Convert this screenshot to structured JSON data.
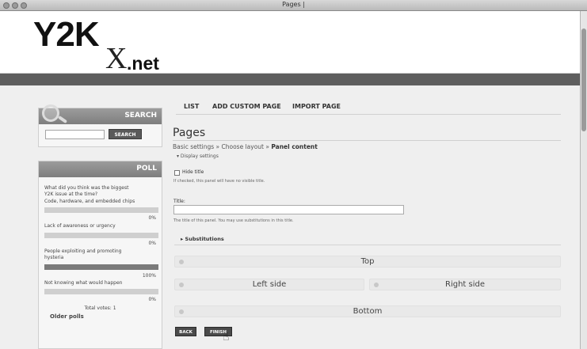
{
  "window": {
    "title": "Pages |"
  },
  "logo": {
    "main": "Y2K",
    "x": "X",
    "net": ".net"
  },
  "search": {
    "title": "SEARCH",
    "button_label": "SEARCH"
  },
  "poll": {
    "title": "POLL",
    "question": [
      "What did you think was the biggest",
      "Y2K issue at the time?"
    ],
    "options": [
      {
        "label": [
          "Code, hardware, and embedded chips"
        ],
        "percent_text": "0%",
        "fraction": 0
      },
      {
        "label": [
          "Lack of awareness or urgency"
        ],
        "percent_text": "0%",
        "fraction": 0
      },
      {
        "label": [
          "People exploiting and promoting",
          "hysteria"
        ],
        "percent_text": "100%",
        "fraction": 1
      },
      {
        "label": [
          "Not knowing what would happen"
        ],
        "percent_text": "0%",
        "fraction": 0
      }
    ],
    "total_votes": "Total votes: 1",
    "older_polls": "Older polls"
  },
  "tabs": [
    "LIST",
    "ADD CUSTOM PAGE",
    "IMPORT PAGE"
  ],
  "page": {
    "title": "Pages",
    "breadcrumb": {
      "step1": "Basic settings",
      "sep": " » ",
      "step2": "Choose layout",
      "step3": "Panel content"
    },
    "display_settings": "▾ Display settings",
    "hide_title": {
      "label": "Hide title",
      "description": "If checked, this panel will have no visible title."
    },
    "title_field": {
      "label": "Title:",
      "value": "",
      "description": "The title of this panel. You may use substitutions in this title."
    },
    "substitutions": "▸ Substitutions",
    "regions": {
      "top": "Top",
      "left": "Left side",
      "right": "Right side",
      "bottom": "Bottom"
    },
    "buttons": {
      "back": "BACK",
      "finish": "FINISH"
    }
  }
}
